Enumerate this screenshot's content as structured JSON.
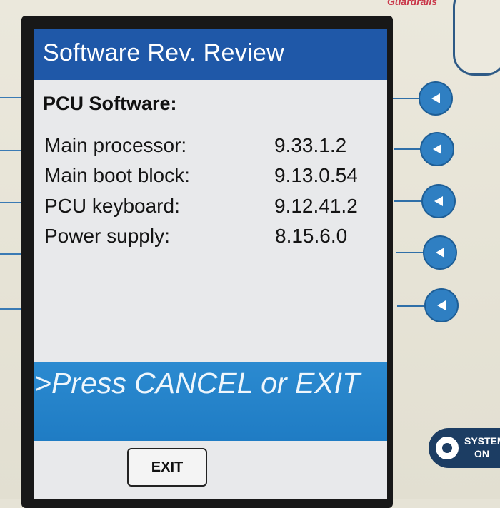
{
  "device": {
    "brand_label": "Guardrails",
    "system_button": {
      "line1": "SYSTEM",
      "line2": "ON"
    }
  },
  "screen": {
    "title": "Software Rev. Review",
    "section_title": "PCU Software:",
    "rows": [
      {
        "label": "Main processor:",
        "value": "9.33.1.2"
      },
      {
        "label": "Main boot block:",
        "value": "9.13.0.54"
      },
      {
        "label": "PCU keyboard:",
        "value": "9.12.41.2"
      },
      {
        "label": "Power supply:",
        "value": "8.15.6.0"
      }
    ],
    "message": ">Press CANCEL or EXIT",
    "softkeys": {
      "exit_label": "EXIT"
    }
  },
  "side_buttons": [
    {
      "icon": "triangle-left-icon"
    },
    {
      "icon": "triangle-left-icon"
    },
    {
      "icon": "triangle-left-icon"
    },
    {
      "icon": "triangle-left-icon"
    },
    {
      "icon": "triangle-left-icon"
    }
  ],
  "colors": {
    "header_bg": "#1f58a8",
    "message_bg": "#1f7cc4",
    "button_blue": "#2f7fc2"
  }
}
